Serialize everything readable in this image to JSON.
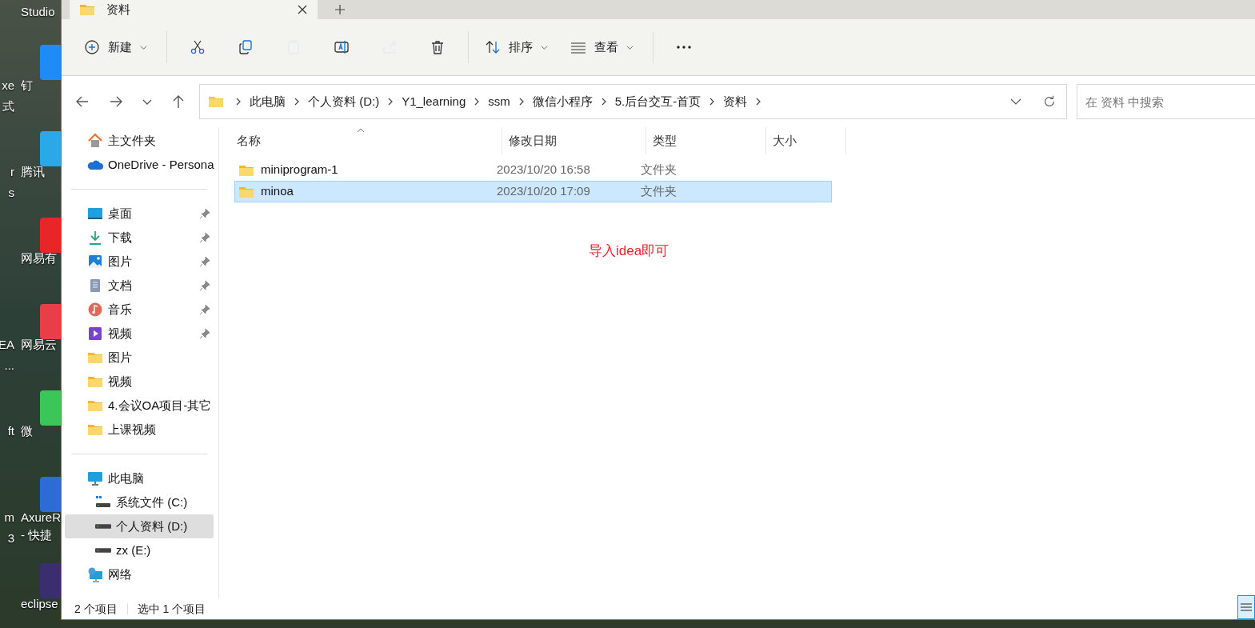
{
  "desktop": {
    "shortcuts": [
      {
        "label": [
          "Studio"
        ]
      },
      {
        "label": [
          "钉"
        ]
      },
      {
        "label": [
          "腾讯"
        ]
      },
      {
        "label": [
          "网易有"
        ]
      },
      {
        "label": [
          "网易云"
        ]
      },
      {
        "label": [
          "微"
        ]
      },
      {
        "label": [
          "AxureR",
          "- 快捷"
        ]
      },
      {
        "label": [
          "eclipse"
        ]
      }
    ],
    "cut_labels": [
      {
        "label": [
          "xe",
          "式"
        ]
      },
      {
        "label": [
          "r",
          "s"
        ]
      },
      {
        "label": [
          "EA",
          "..."
        ]
      },
      {
        "label": [
          "ft"
        ]
      },
      {
        "label": [
          "m",
          "3"
        ]
      }
    ]
  },
  "tab": {
    "title": "资料",
    "selected": true
  },
  "toolbar": [
    {
      "kind": "new",
      "label": "新建",
      "disabled": false
    },
    {
      "kind": "cut",
      "disabled": false
    },
    {
      "kind": "copy",
      "disabled": false
    },
    {
      "kind": "paste",
      "disabled": true
    },
    {
      "kind": "rename",
      "disabled": false
    },
    {
      "kind": "share",
      "disabled": true
    },
    {
      "kind": "delete",
      "disabled": false
    },
    {
      "kind": "sort",
      "label": "排序",
      "disabled": false
    },
    {
      "kind": "view",
      "label": "查看",
      "disabled": false
    },
    {
      "kind": "more",
      "disabled": false
    }
  ],
  "breadcrumb": [
    "此电脑",
    "个人资料 (D:)",
    "Y1_learning",
    "ssm",
    "微信小程序",
    "5.后台交互-首页",
    "资料"
  ],
  "search": {
    "placeholder": "在 资料 中搜索"
  },
  "sidebar": {
    "groups": [
      [
        {
          "kind": "home",
          "label": "主文件夹",
          "pinned": false,
          "selected": false
        },
        {
          "kind": "cloud",
          "label": "OneDrive - Persona",
          "pinned": false,
          "selected": false
        }
      ],
      [
        {
          "kind": "desktop",
          "label": "桌面",
          "pinned": true,
          "selected": false
        },
        {
          "kind": "download",
          "label": "下载",
          "pinned": true,
          "selected": false
        },
        {
          "kind": "pictures",
          "label": "图片",
          "pinned": true,
          "selected": false
        },
        {
          "kind": "docs",
          "label": "文档",
          "pinned": true,
          "selected": false
        },
        {
          "kind": "music",
          "label": "音乐",
          "pinned": true,
          "selected": false
        },
        {
          "kind": "video",
          "label": "视频",
          "pinned": true,
          "selected": false
        },
        {
          "kind": "folder",
          "label": "图片",
          "pinned": false,
          "selected": false
        },
        {
          "kind": "folder",
          "label": "视频",
          "pinned": false,
          "selected": false
        },
        {
          "kind": "folder",
          "label": "4.会议OA项目-其它",
          "pinned": false,
          "selected": false
        },
        {
          "kind": "folder",
          "label": "上课视频",
          "pinned": false,
          "selected": false
        }
      ],
      [
        {
          "kind": "pc",
          "label": "此电脑",
          "pinned": false,
          "selected": false,
          "children": [
            {
              "kind": "sysdrive",
              "label": "系统文件 (C:)",
              "pinned": false,
              "selected": false
            },
            {
              "kind": "drive",
              "label": "个人资料 (D:)",
              "pinned": false,
              "selected": true
            },
            {
              "kind": "drive",
              "label": "zx (E:)",
              "pinned": false,
              "selected": false
            }
          ]
        },
        {
          "kind": "network",
          "label": "网络",
          "pinned": false,
          "selected": false
        }
      ]
    ]
  },
  "table": {
    "columns": [
      "名称",
      "修改日期",
      "类型",
      "大小"
    ],
    "rows": [
      {
        "name": "miniprogram-1",
        "date": "2023/10/20 16:58",
        "type": "文件夹",
        "selected": false
      },
      {
        "name": "minoa",
        "date": "2023/10/20 17:09",
        "type": "文件夹",
        "selected": true
      }
    ]
  },
  "annotation": "导入idea即可",
  "status_bar": {
    "count": "2 个项目",
    "selection": "选中 1 个项目"
  }
}
